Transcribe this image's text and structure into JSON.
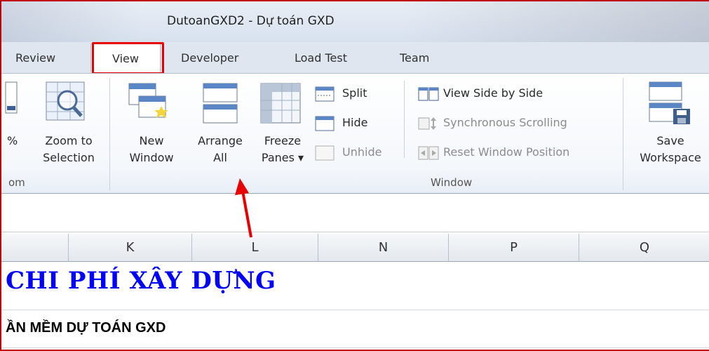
{
  "window": {
    "title": "DutoanGXD2 - Dự toán GXD"
  },
  "tabs": [
    {
      "label": "Review",
      "active": false
    },
    {
      "label": "View",
      "active": true
    },
    {
      "label": "Developer",
      "active": false
    },
    {
      "label": "Load Test",
      "active": false
    },
    {
      "label": "Team",
      "active": false
    }
  ],
  "ribbon": {
    "zoom_group": {
      "label": "om",
      "percent_label": "%",
      "zoom_to_selection": {
        "line1": "Zoom to",
        "line2": "Selection"
      }
    },
    "window_group": {
      "label": "Window",
      "new_window": {
        "line1": "New",
        "line2": "Window"
      },
      "arrange_all": {
        "line1": "Arrange",
        "line2": "All"
      },
      "freeze_panes": {
        "line1": "Freeze",
        "line2": "Panes ▾"
      },
      "split": "Split",
      "hide": "Hide",
      "unhide": "Unhide",
      "view_side_by_side": "View Side by Side",
      "synchronous_scrolling": "Synchronous Scrolling",
      "reset_window_position": "Reset Window Position"
    },
    "save_workspace": {
      "line1": "Save",
      "line2": "Workspace"
    }
  },
  "columns": [
    "K",
    "L",
    "N",
    "P",
    "Q"
  ],
  "sheet": {
    "row1": "CHI PHÍ XÂY DỰNG",
    "row2": "ẦN MỀM DỰ TOÁN GXD"
  },
  "colors": {
    "highlight": "#e60000",
    "heading_blue": "#0000ff",
    "arrow": "#e60000"
  }
}
